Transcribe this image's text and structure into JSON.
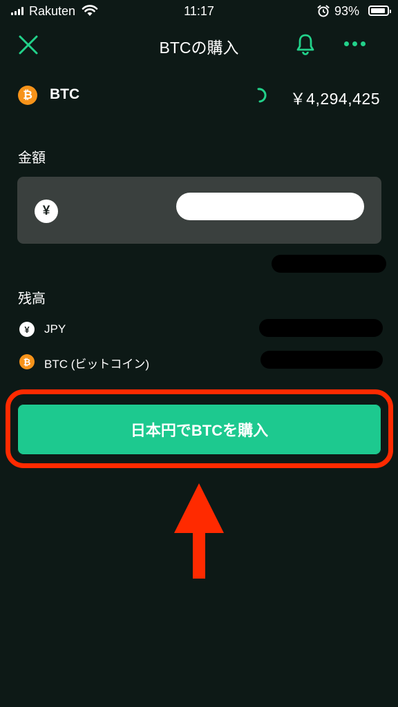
{
  "status_bar": {
    "carrier": "Rakuten",
    "time": "11:17",
    "battery_pct": "93%",
    "battery_level": 0.93
  },
  "header": {
    "title": "BTCの購入",
    "accent_color": "#22d18a"
  },
  "asset": {
    "symbol_glyph": "₿",
    "name": "BTC",
    "price": "￥4,294,425"
  },
  "amount": {
    "label": "金額",
    "currency_glyph": "¥",
    "input_value": ""
  },
  "balance": {
    "label": "残高",
    "items": [
      {
        "glyph": "¥",
        "name": "JPY"
      },
      {
        "glyph": "₿",
        "name": "BTC (ビットコイン)"
      }
    ]
  },
  "action": {
    "buy_label": "日本円でBTCを購入",
    "button_color": "#1dc98f",
    "highlight_color": "#ff2a00"
  }
}
